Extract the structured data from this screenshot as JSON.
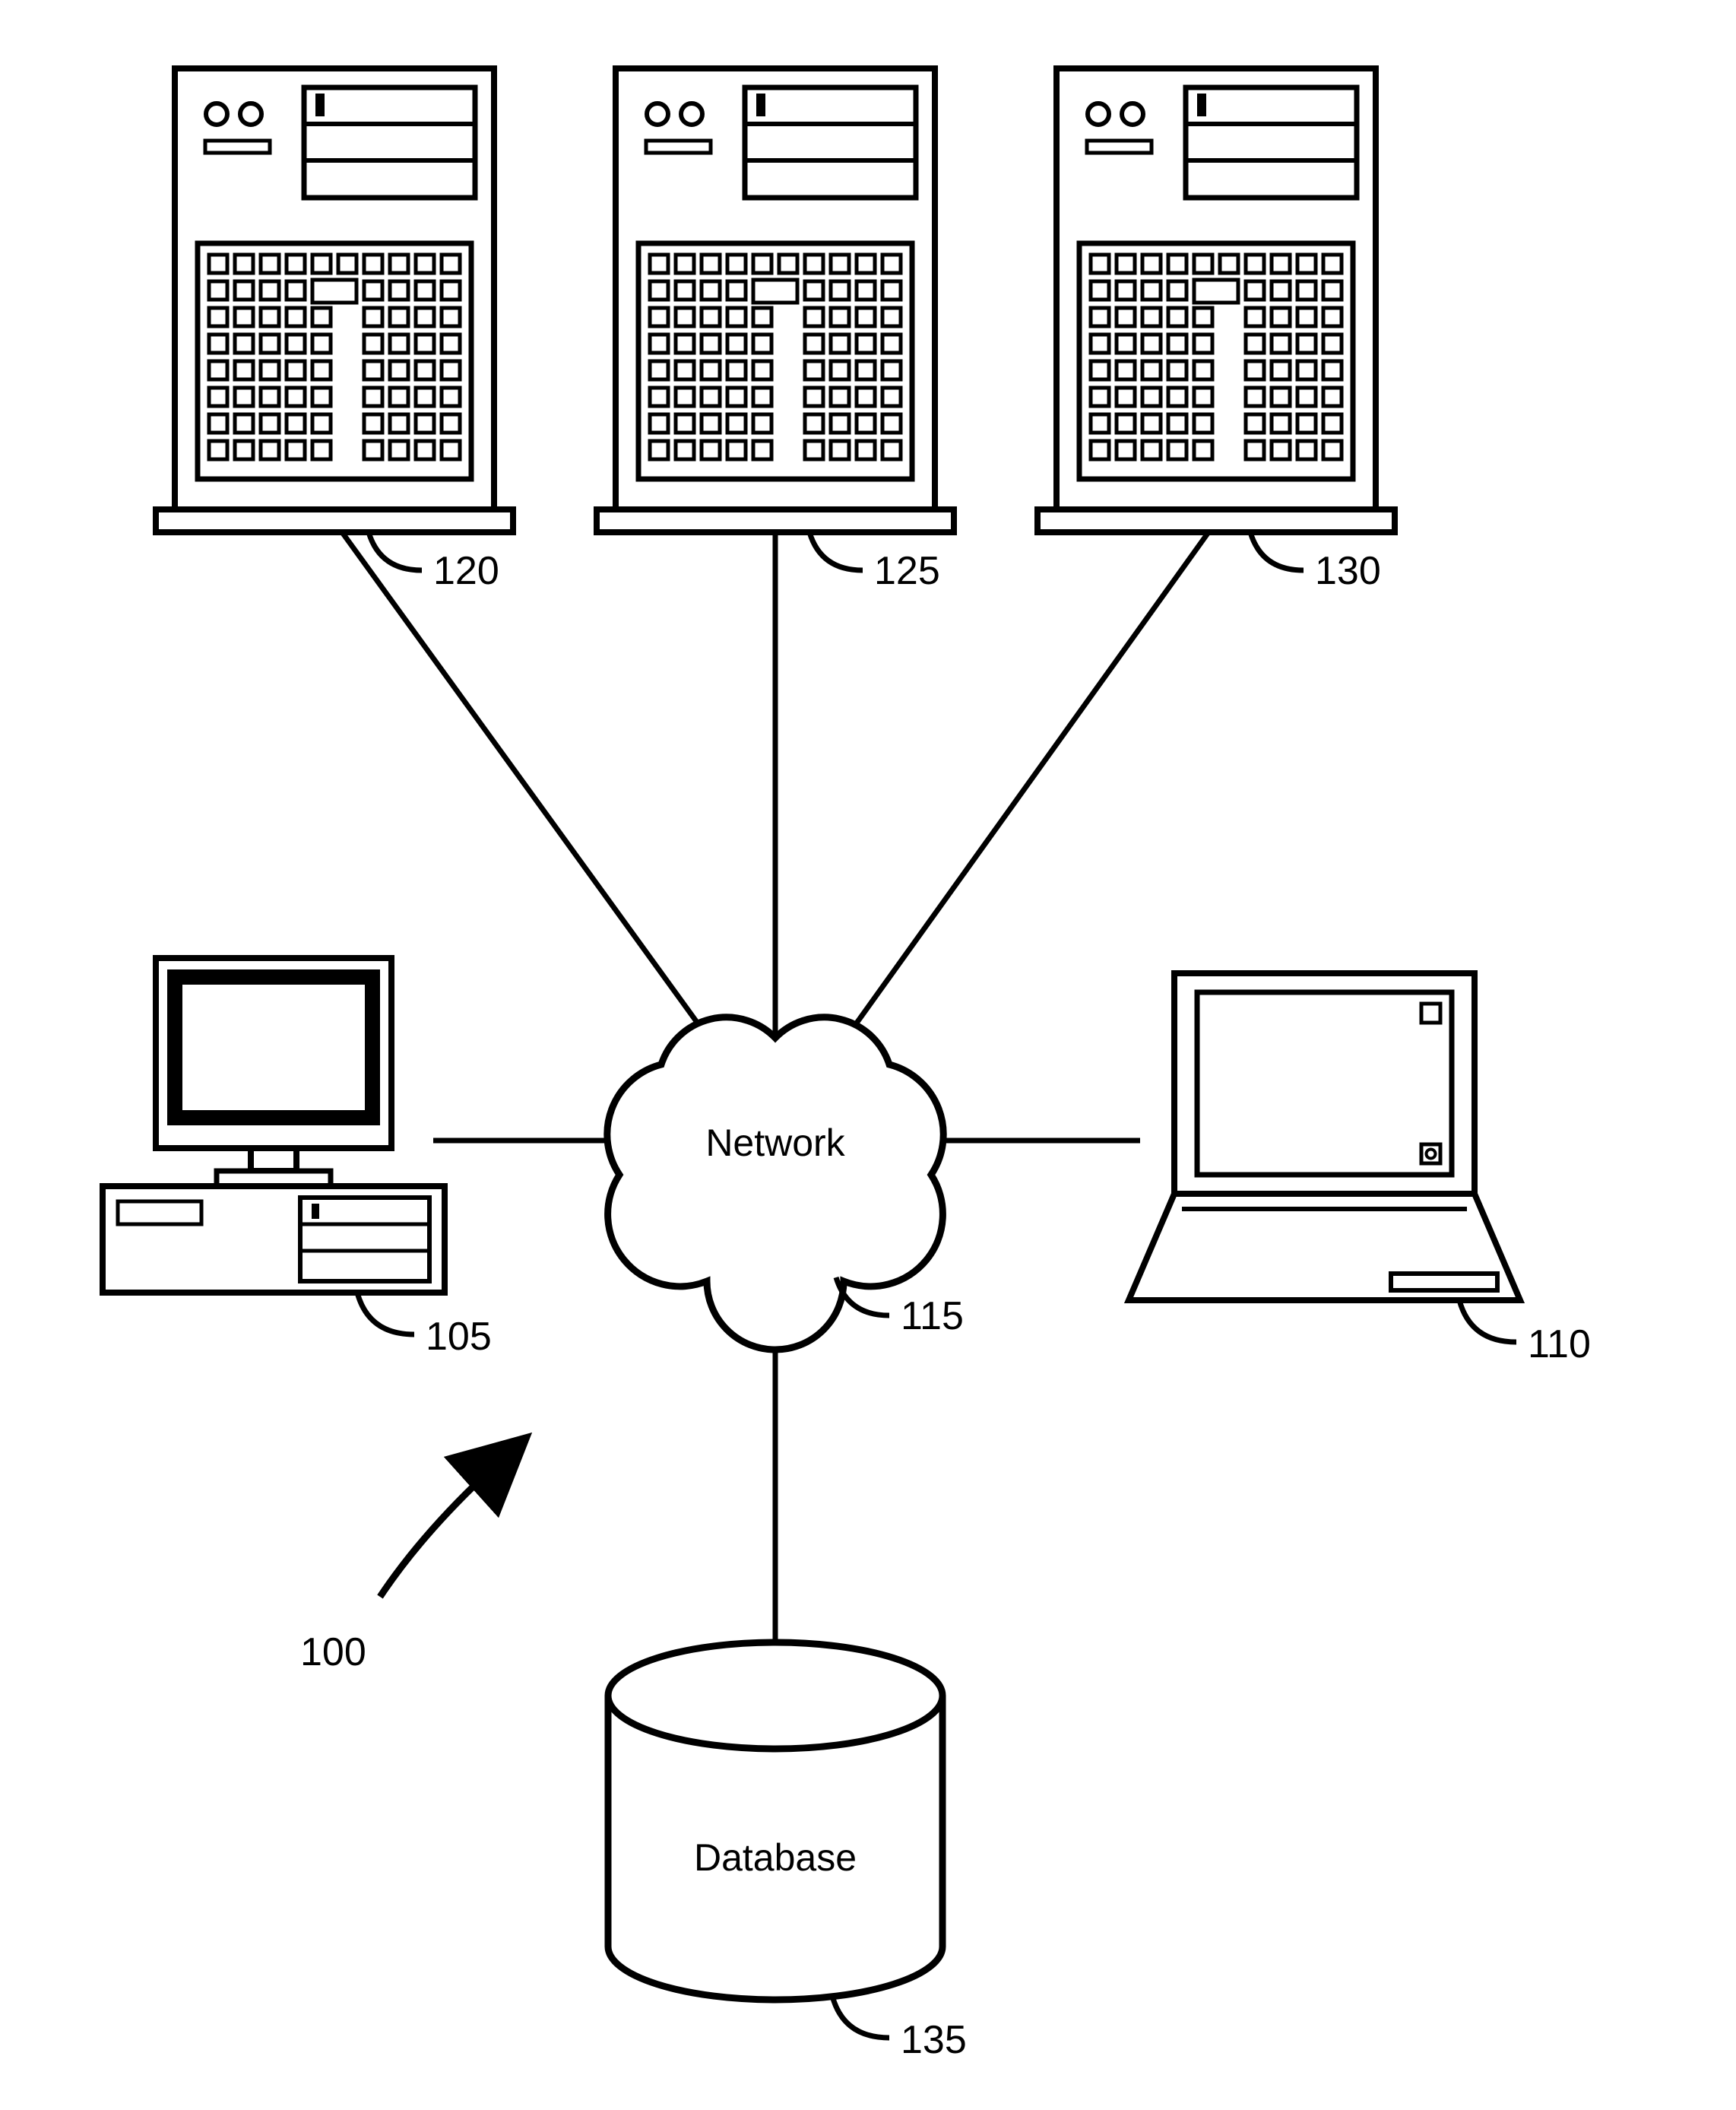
{
  "labels": {
    "network": "Network",
    "database": "Database",
    "systemRef": "100",
    "server1Ref": "120",
    "server2Ref": "125",
    "server3Ref": "130",
    "desktopRef": "105",
    "laptopRef": "110",
    "networkRef": "115",
    "databaseRef": "135"
  }
}
